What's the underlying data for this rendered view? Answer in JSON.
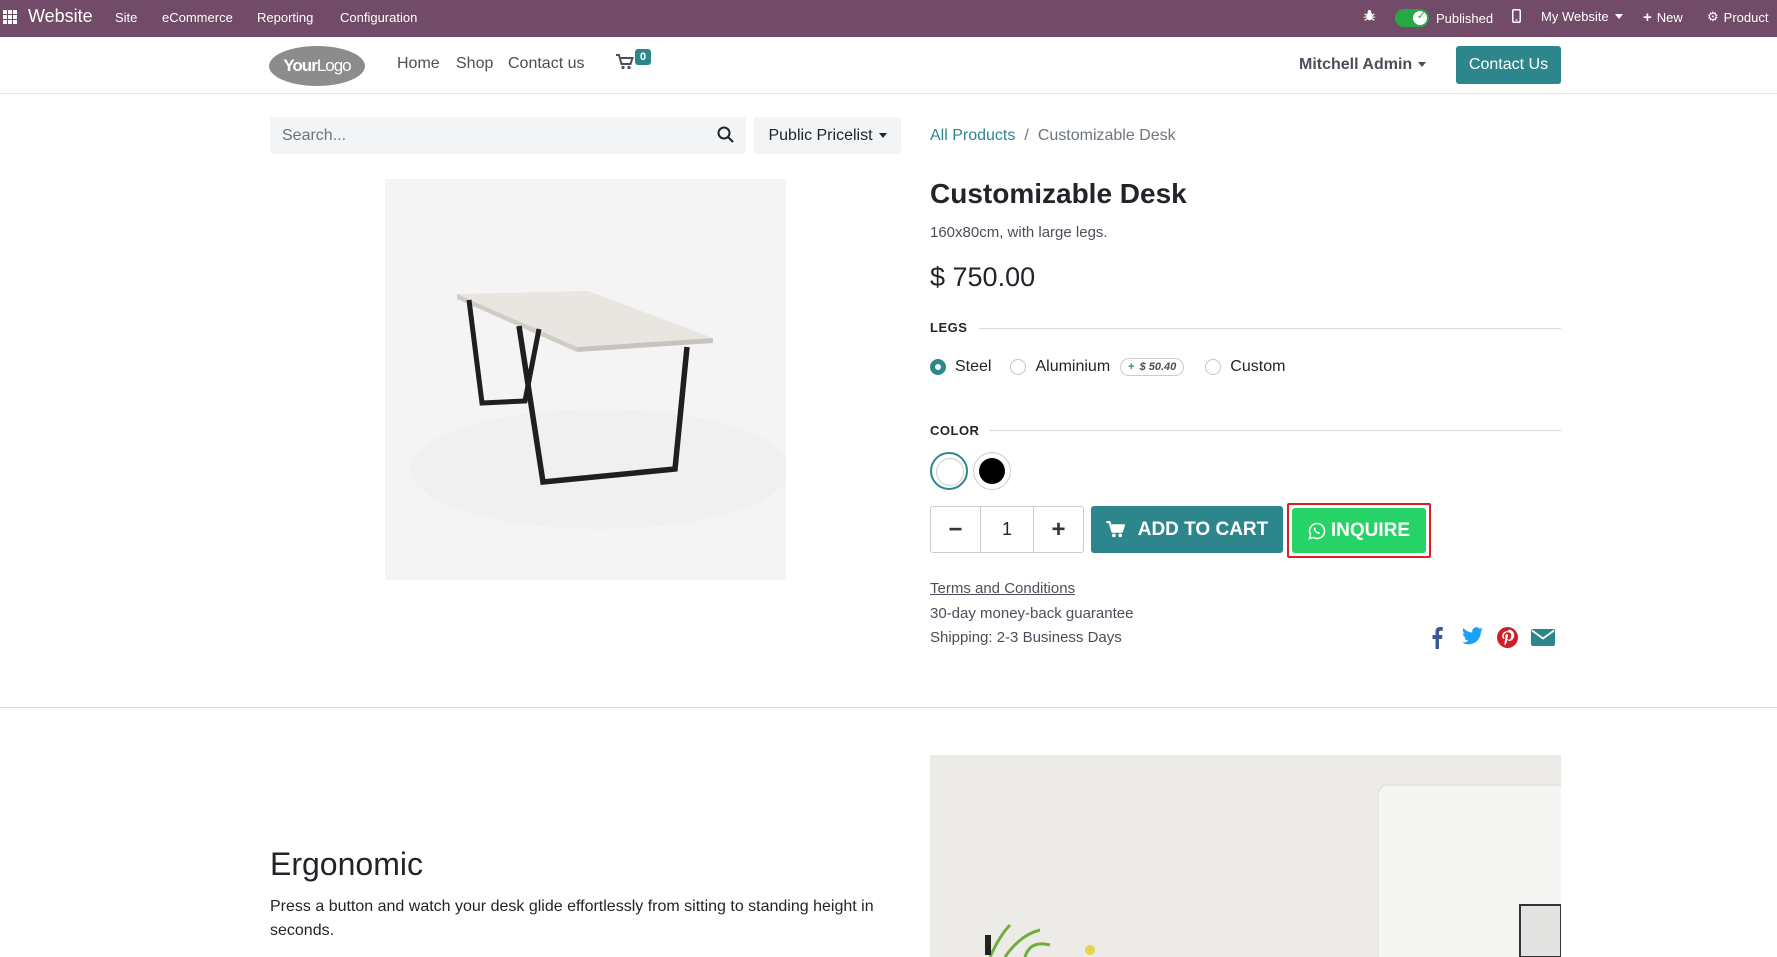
{
  "adminbar": {
    "brand": "Website",
    "menus": [
      "Site",
      "eCommerce",
      "Reporting",
      "Configuration"
    ],
    "published_label": "Published",
    "website_label": "My Website",
    "new_label": "New",
    "product_label": "Product"
  },
  "header": {
    "logo_bold": "Your",
    "logo_light": "Logo",
    "nav": [
      "Home",
      "Shop",
      "Contact us"
    ],
    "cart_count": "0",
    "user": "Mitchell Admin",
    "contact_button": "Contact Us"
  },
  "search": {
    "placeholder": "Search..."
  },
  "pricelist": {
    "label": "Public Pricelist"
  },
  "breadcrumb": {
    "parent": "All Products",
    "separator": "/",
    "current": "Customizable Desk"
  },
  "product": {
    "title": "Customizable Desk",
    "description": "160x80cm, with large legs.",
    "price": "$ 750.00"
  },
  "attributes": {
    "legs": {
      "heading": "LEGS",
      "options": [
        {
          "label": "Steel",
          "checked": true
        },
        {
          "label": "Aluminium",
          "extra": "$ 50.40"
        },
        {
          "label": "Custom"
        }
      ],
      "extra_prefix": "+"
    },
    "color": {
      "heading": "COLOR",
      "swatches": [
        {
          "name": "white",
          "color": "#ffffff",
          "selected": true
        },
        {
          "name": "black",
          "color": "#000000"
        }
      ]
    }
  },
  "cart_actions": {
    "quantity": "1",
    "minus": "−",
    "plus": "+",
    "add_to_cart": "ADD TO CART",
    "inquire": "INQUIRE"
  },
  "info": {
    "terms": "Terms and Conditions",
    "guarantee": "30-day money-back guarantee",
    "shipping": "Shipping: 2-3 Business Days"
  },
  "social_icons": [
    "facebook-icon",
    "twitter-icon",
    "pinterest-icon",
    "email-icon"
  ],
  "section": {
    "title": "Ergonomic",
    "text": "Press a button and watch your desk glide effortlessly from sitting to standing height in seconds."
  },
  "colors": {
    "admin_bar": "#714B67",
    "primary": "#2e868d",
    "whatsapp": "#25d366",
    "highlight": "#e02020"
  }
}
